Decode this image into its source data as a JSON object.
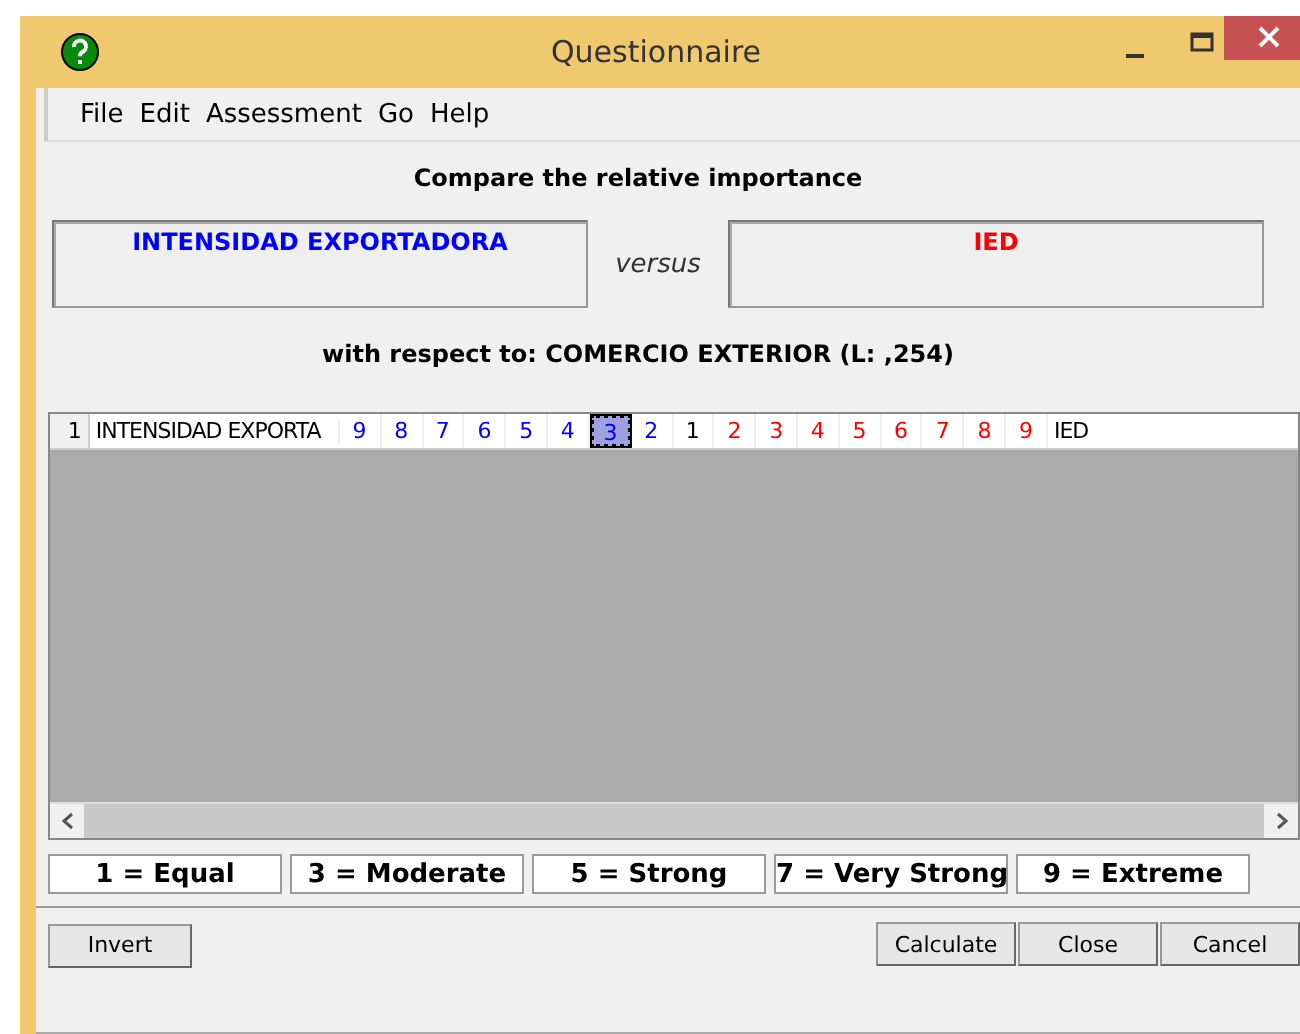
{
  "window": {
    "title": "Questionnaire"
  },
  "menu": [
    {
      "label": "File"
    },
    {
      "label": "Edit"
    },
    {
      "label": "Assessment"
    },
    {
      "label": "Go"
    },
    {
      "label": "Help"
    }
  ],
  "heading": "Compare the relative importance",
  "left_item": "INTENSIDAD EXPORTADORA",
  "versus": "versus",
  "right_item": "IED",
  "context": "with respect to: COMERCIO EXTERIOR (L: ,254)",
  "grid": {
    "row_number": "1",
    "left_label": "INTENSIDAD EXPORTA",
    "right_label": "IED",
    "cells": [
      {
        "text": "9",
        "color": "#0000ff",
        "selected": false
      },
      {
        "text": "8",
        "color": "#0000ff",
        "selected": false
      },
      {
        "text": "7",
        "color": "#0000ff",
        "selected": false
      },
      {
        "text": "6",
        "color": "#0000ff",
        "selected": false
      },
      {
        "text": "5",
        "color": "#0000ff",
        "selected": false
      },
      {
        "text": "4",
        "color": "#0000ff",
        "selected": false
      },
      {
        "text": "3",
        "color": "#0000ff",
        "selected": true
      },
      {
        "text": "2",
        "color": "#0000ff",
        "selected": false
      },
      {
        "text": "1",
        "color": "#000000",
        "selected": false
      },
      {
        "text": "2",
        "color": "#ff0000",
        "selected": false
      },
      {
        "text": "3",
        "color": "#ff0000",
        "selected": false
      },
      {
        "text": "4",
        "color": "#ff0000",
        "selected": false
      },
      {
        "text": "5",
        "color": "#ff0000",
        "selected": false
      },
      {
        "text": "6",
        "color": "#ff0000",
        "selected": false
      },
      {
        "text": "7",
        "color": "#ff0000",
        "selected": false
      },
      {
        "text": "8",
        "color": "#ff0000",
        "selected": false
      },
      {
        "text": "9",
        "color": "#ff0000",
        "selected": false
      }
    ]
  },
  "legend": [
    "1 = Equal",
    "3 = Moderate",
    "5 = Strong",
    "7 = Very Strong",
    "9 = Extreme"
  ],
  "buttons_left": [
    {
      "label": "Invert"
    }
  ],
  "buttons_right": [
    {
      "label": "Calculate"
    },
    {
      "label": "Close"
    },
    {
      "label": "Cancel"
    }
  ]
}
